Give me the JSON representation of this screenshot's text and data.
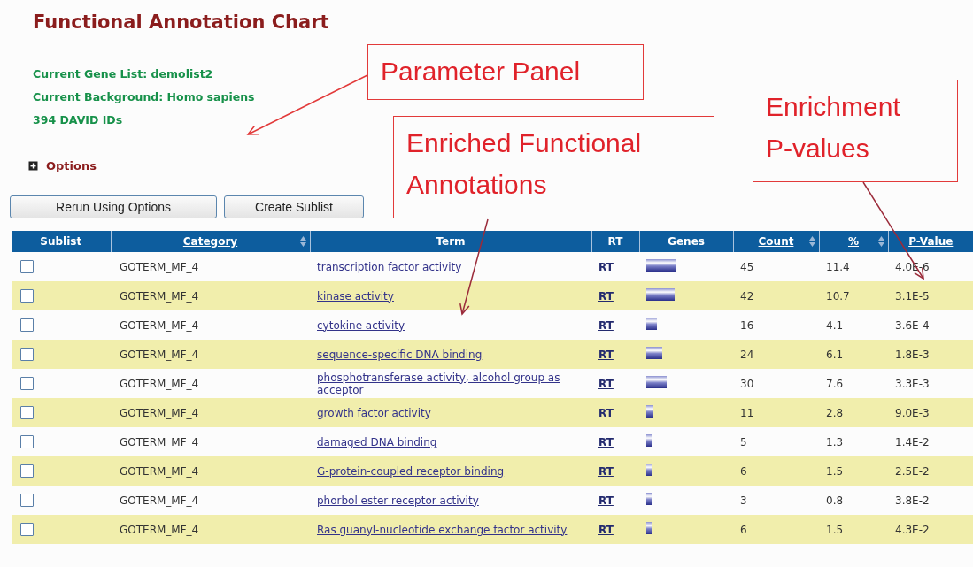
{
  "page_title": "Functional Annotation Chart",
  "info_lines": [
    "Current Gene List: demolist2",
    "Current Background: Homo sapiens",
    "394 DAVID IDs"
  ],
  "options": {
    "label": "Options",
    "expanded": false
  },
  "buttons": [
    "Rerun Using Options",
    "Create Sublist"
  ],
  "table": {
    "columns": [
      {
        "label": "Sublist",
        "link": false,
        "sortable": false
      },
      {
        "label": "Category",
        "link": true,
        "sortable": true
      },
      {
        "label": "Term",
        "link": false,
        "sortable": false
      },
      {
        "label": "RT",
        "link": false,
        "sortable": false
      },
      {
        "label": "Genes",
        "link": false,
        "sortable": false
      },
      {
        "label": "Count",
        "link": true,
        "sortable": true
      },
      {
        "label": "%",
        "link": true,
        "sortable": true
      },
      {
        "label": "P-Value",
        "link": true,
        "sortable": false
      }
    ],
    "rows": [
      {
        "checked": false,
        "category": "GOTERM_MF_4",
        "term": "transcription factor activity",
        "rt": "RT",
        "count": "45",
        "percent": "11.4",
        "p_value": "4.0E-6"
      },
      {
        "checked": false,
        "category": "GOTERM_MF_4",
        "term": "kinase activity",
        "rt": "RT",
        "count": "42",
        "percent": "10.7",
        "p_value": "3.1E-5"
      },
      {
        "checked": false,
        "category": "GOTERM_MF_4",
        "term": "cytokine activity",
        "rt": "RT",
        "count": "16",
        "percent": "4.1",
        "p_value": "3.6E-4"
      },
      {
        "checked": false,
        "category": "GOTERM_MF_4",
        "term": "sequence-specific DNA binding",
        "rt": "RT",
        "count": "24",
        "percent": "6.1",
        "p_value": "1.8E-3"
      },
      {
        "checked": false,
        "category": "GOTERM_MF_4",
        "term": "phosphotransferase activity, alcohol group as acceptor",
        "rt": "RT",
        "count": "30",
        "percent": "7.6",
        "p_value": "3.3E-3"
      },
      {
        "checked": false,
        "category": "GOTERM_MF_4",
        "term": "growth factor activity",
        "rt": "RT",
        "count": "11",
        "percent": "2.8",
        "p_value": "9.0E-3"
      },
      {
        "checked": false,
        "category": "GOTERM_MF_4",
        "term": "damaged DNA binding",
        "rt": "RT",
        "count": "5",
        "percent": "1.3",
        "p_value": "1.4E-2"
      },
      {
        "checked": false,
        "category": "GOTERM_MF_4",
        "term": "G-protein-coupled receptor binding",
        "rt": "RT",
        "count": "6",
        "percent": "1.5",
        "p_value": "2.5E-2"
      },
      {
        "checked": false,
        "category": "GOTERM_MF_4",
        "term": "phorbol ester receptor activity",
        "rt": "RT",
        "count": "3",
        "percent": "0.8",
        "p_value": "3.8E-2"
      },
      {
        "checked": false,
        "category": "GOTERM_MF_4",
        "term": "Ras guanyl-nucleotide exchange factor activity",
        "rt": "RT",
        "count": "6",
        "percent": "1.5",
        "p_value": "4.3E-2"
      }
    ]
  },
  "callouts": [
    {
      "lines": [
        "Parameter Panel"
      ]
    },
    {
      "lines": [
        "Enriched Functional",
        "Annotations"
      ]
    },
    {
      "lines": [
        "Enrichment",
        "P-values"
      ]
    }
  ]
}
